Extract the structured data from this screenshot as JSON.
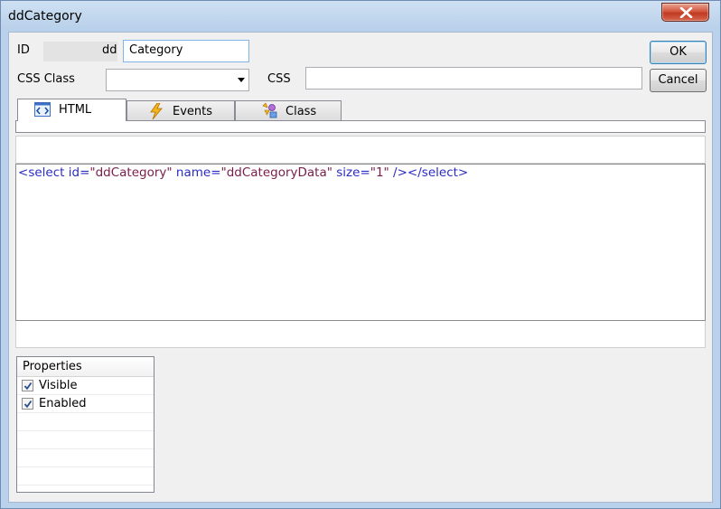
{
  "window": {
    "title": "ddCategory"
  },
  "form": {
    "id_label": "ID",
    "id_prefix": "dd",
    "id_value": "Category",
    "css_class_label": "CSS Class",
    "css_class_value": "",
    "css_label": "CSS",
    "css_value": ""
  },
  "buttons": {
    "ok": "OK",
    "cancel": "Cancel"
  },
  "tabs": [
    {
      "label": "HTML",
      "icon": "html-icon",
      "active": true
    },
    {
      "label": "Events",
      "icon": "lightning-icon",
      "active": false
    },
    {
      "label": "Class",
      "icon": "class-icon",
      "active": false
    }
  ],
  "editor": {
    "code_parts": [
      {
        "text": "<",
        "kind": "punct"
      },
      {
        "text": "select",
        "kind": "tag"
      },
      {
        "text": " id",
        "kind": "attr"
      },
      {
        "text": "=",
        "kind": "punct"
      },
      {
        "text": "\"ddCategory\"",
        "kind": "val"
      },
      {
        "text": " name",
        "kind": "attr"
      },
      {
        "text": "=",
        "kind": "punct"
      },
      {
        "text": "\"ddCategoryData\"",
        "kind": "val"
      },
      {
        "text": " size",
        "kind": "attr"
      },
      {
        "text": "=",
        "kind": "punct"
      },
      {
        "text": "\"1\"",
        "kind": "val"
      },
      {
        "text": " />",
        "kind": "punct"
      },
      {
        "text": "</",
        "kind": "punct"
      },
      {
        "text": "select",
        "kind": "tag"
      },
      {
        "text": ">",
        "kind": "punct"
      }
    ]
  },
  "properties": {
    "header": "Properties",
    "items": [
      {
        "label": "Visible",
        "checked": true
      },
      {
        "label": "Enabled",
        "checked": true
      }
    ]
  },
  "colors": {
    "code_tag": "#2b2bc6",
    "code_value": "#7a1c4a",
    "close_button": "#c13a22"
  }
}
